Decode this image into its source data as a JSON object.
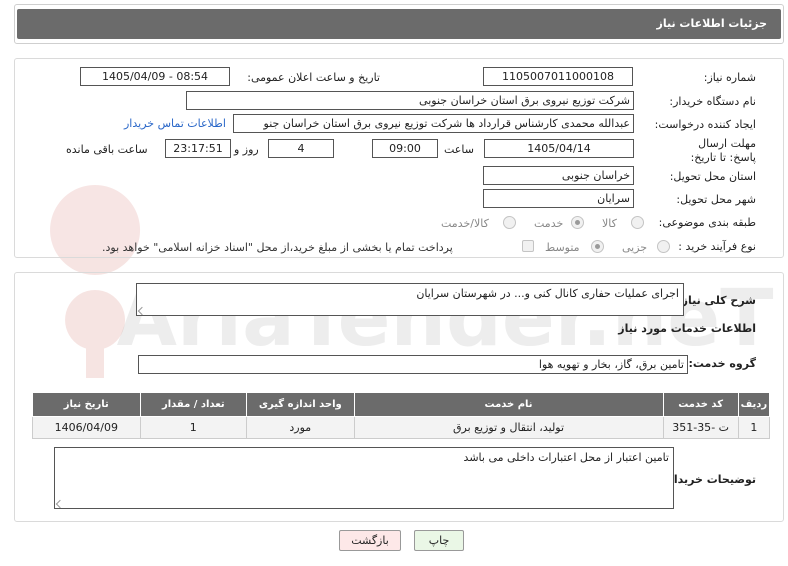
{
  "header": {
    "title": "جزئیات اطلاعات نیاز"
  },
  "form": {
    "need_number": {
      "label": "شماره نیاز:",
      "value": "1105007011000108"
    },
    "announce_datetime": {
      "label": "تاریخ و ساعت اعلان عمومی:",
      "value": "1405/04/09 - 08:54"
    },
    "buyer_org": {
      "label": "نام دستگاه خریدار:",
      "value": "شرکت توزیع نیروی برق استان خراسان جنوبی"
    },
    "requester": {
      "label": "ایجاد کننده درخواست:",
      "value": "عبدالله محمدی کارشناس قرارداد ها شرکت توزیع نیروی برق استان خراسان جنو",
      "contact_link": "اطلاعات تماس خریدار"
    },
    "deadline": {
      "label": "مهلت ارسال پاسخ: تا تاریخ:",
      "date": "1405/04/14",
      "time_label": "ساعت",
      "time": "09:00",
      "days": "4",
      "days_label": "روز و",
      "remaining": "23:17:51",
      "remaining_label": "ساعت باقی مانده"
    },
    "province": {
      "label": "استان محل تحویل:",
      "value": "خراسان جنوبی"
    },
    "city": {
      "label": "شهر محل تحویل:",
      "value": "سرایان"
    },
    "category": {
      "label": "طبقه بندی موضوعی:",
      "options": [
        "کالا",
        "خدمت",
        "کالا/خدمت"
      ],
      "selected": "خدمت"
    },
    "process_type": {
      "label": "نوع فرآیند خرید :",
      "options": [
        "جزیی",
        "متوسط"
      ],
      "selected": "متوسط",
      "payment_note": "پرداخت تمام یا بخشی از مبلغ خرید،از محل \"اسناد خزانه اسلامی\" خواهد بود."
    }
  },
  "description": {
    "label": "شرح کلی نیاز:",
    "value": "اجرای عملیات حفاری کانال کنی و... در شهرستان سرایان"
  },
  "services": {
    "section_title": "اطلاعات خدمات مورد نیاز",
    "group_label": "گروه خدمت:",
    "group_value": "تامین برق، گاز، بخار و تهویه هوا",
    "columns": [
      "ردیف",
      "کد خدمت",
      "نام خدمت",
      "واحد اندازه گیری",
      "تعداد / مقدار",
      "تاریخ نیاز"
    ],
    "rows": [
      [
        "1",
        "ت -35-351",
        "تولید، انتقال و توزیع برق",
        "مورد",
        "1",
        "1406/04/09"
      ]
    ]
  },
  "buyer_notes": {
    "label": "توضیحات خریدار:",
    "value": "تامین اعتبار از محل اعتبارات داخلی می باشد"
  },
  "buttons": {
    "print": "چاپ",
    "back": "بازگشت"
  },
  "watermark": {
    "text": "AriaTender.neT"
  },
  "colors": {
    "header_bg": "#6b6b6b",
    "link": "#2a67c8",
    "back_button_bg": "#fde8e8",
    "print_button_bg": "#eaf7e6"
  }
}
